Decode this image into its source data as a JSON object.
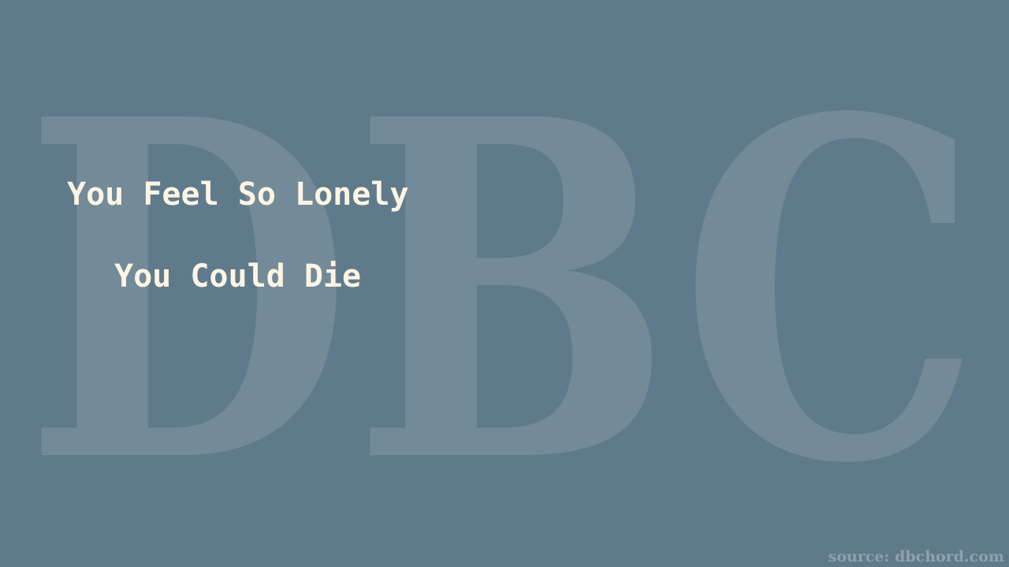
{
  "watermark": {
    "letters": "DBC"
  },
  "lyrics": {
    "line1": "You Feel So Lonely",
    "line2": "You Could Die"
  },
  "source": {
    "text": "source: dbchord.com"
  },
  "colors": {
    "background": "#5f7b8b",
    "watermark": "#738b98",
    "lyric_text": "#fdf5e4",
    "source_text": "#8ea1ac"
  }
}
